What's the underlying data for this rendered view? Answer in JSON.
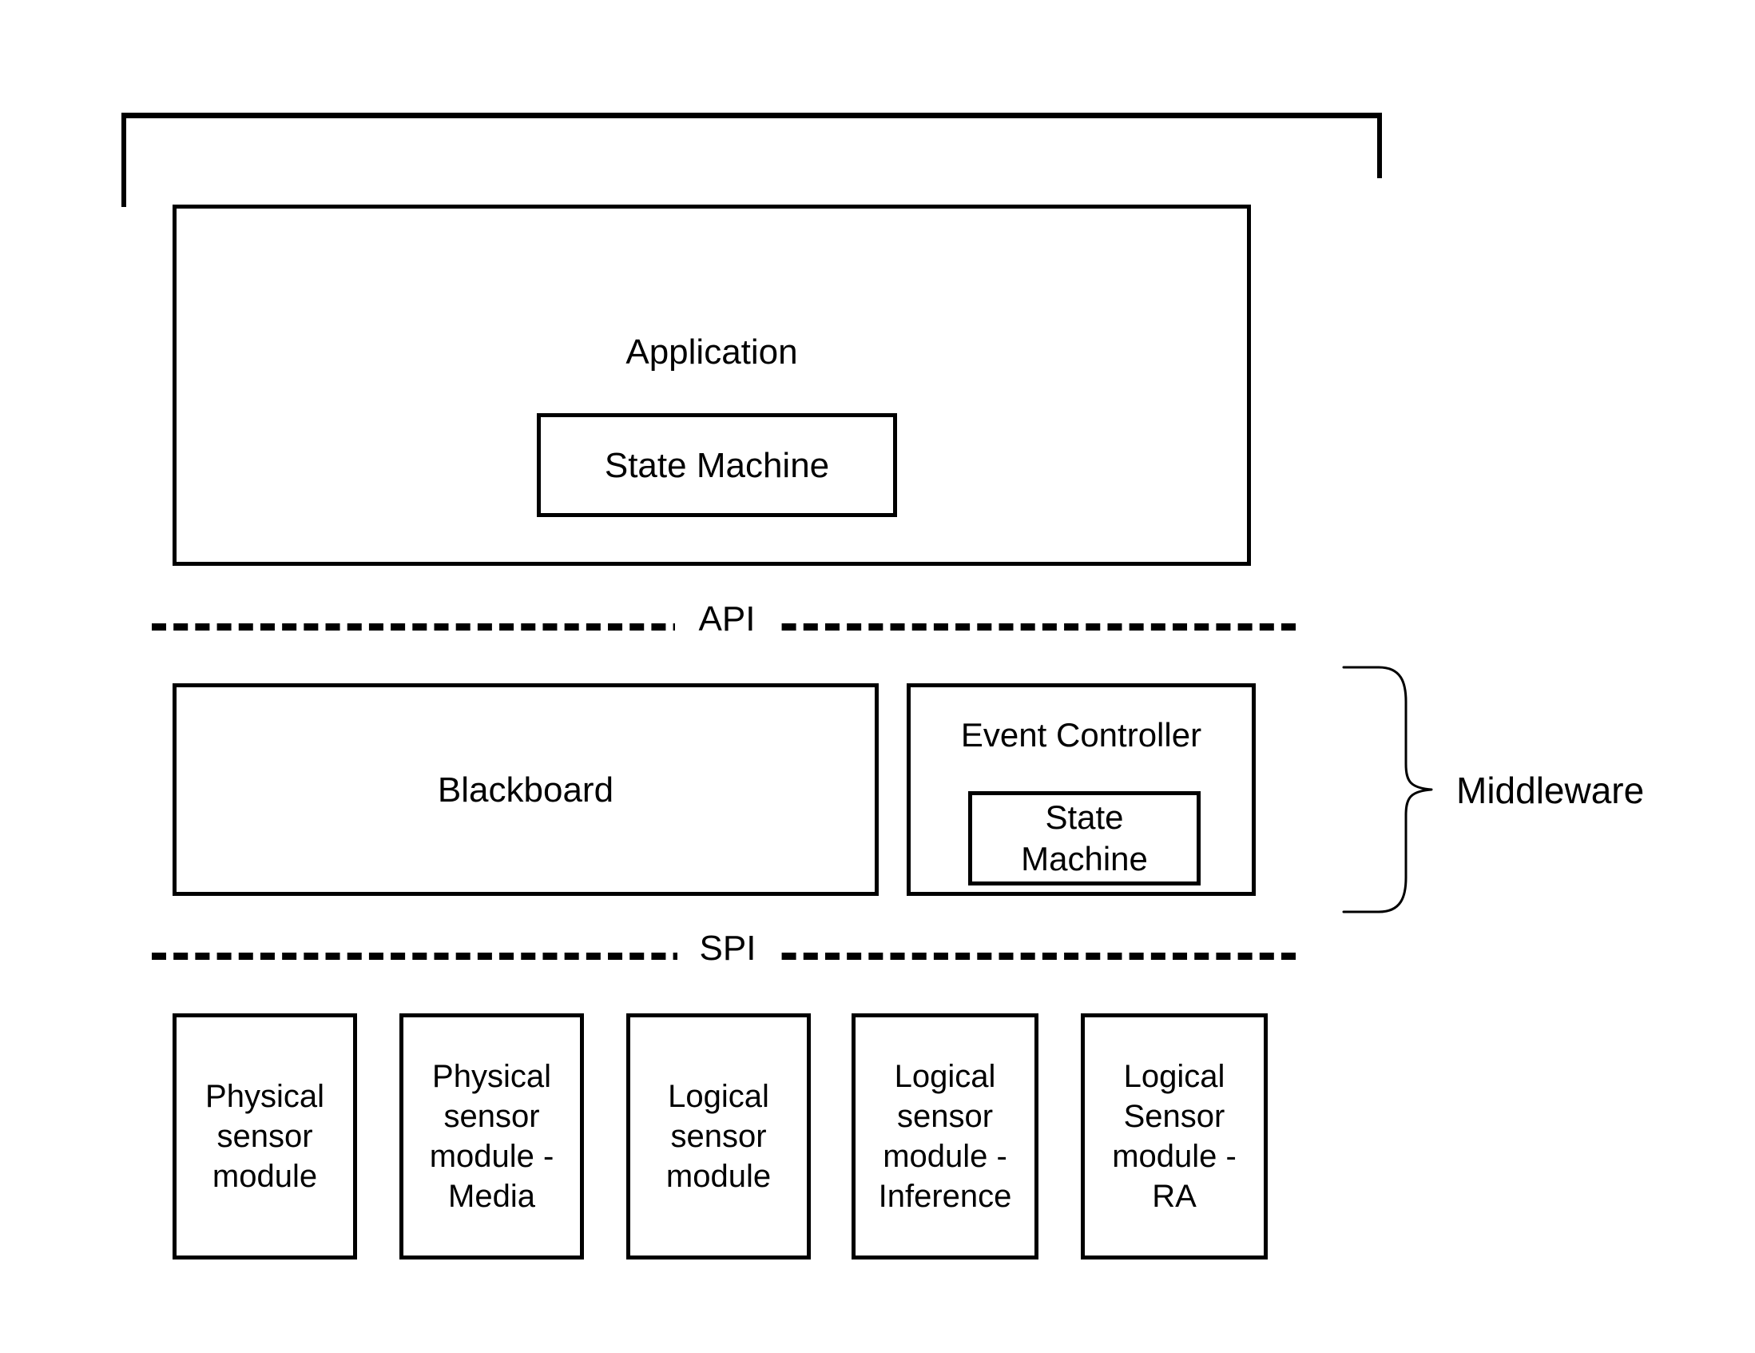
{
  "diagram": {
    "title_hidden": "",
    "application": {
      "label": "Application",
      "inner": {
        "label": "State Machine"
      }
    },
    "interfaces": {
      "api": "API",
      "spi": "SPI"
    },
    "middleware": {
      "bracket_label": "Middleware",
      "blackboard": {
        "label": "Blackboard"
      },
      "event_controller": {
        "label": "Event Controller",
        "inner": {
          "label": "State\nMachine",
          "line1": "State",
          "line2": "Machine"
        }
      }
    },
    "sensor_modules": [
      {
        "label": "Physical sensor module",
        "line1": "Physical",
        "line2": "sensor",
        "line3": "module",
        "line4": ""
      },
      {
        "label": "Physical sensor module - Media",
        "line1": "Physical",
        "line2": "sensor",
        "line3": "module -",
        "line4": "Media"
      },
      {
        "label": "Logical sensor module",
        "line1": "Logical",
        "line2": "sensor",
        "line3": "module",
        "line4": ""
      },
      {
        "label": "Logical sensor module - Inference",
        "line1": "Logical",
        "line2": "sensor",
        "line3": "module -",
        "line4": "Inference"
      },
      {
        "label": "Logical Sensor module - RA",
        "line1": "Logical",
        "line2": "Sensor",
        "line3": "module -",
        "line4": "RA"
      }
    ],
    "colors": {
      "stroke": "#000000",
      "background": "#ffffff",
      "text": "#000000"
    }
  }
}
